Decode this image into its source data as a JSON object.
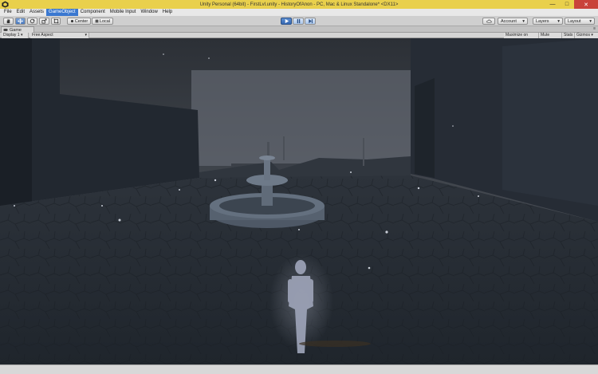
{
  "window": {
    "title": "Unity Personal (64bit) - FirstLvl.unity - HistoryOfAnon - PC, Mac & Linux Standalone* <DX11>",
    "minimize_glyph": "—",
    "maximize_glyph": "□",
    "close_glyph": "✕"
  },
  "menu": {
    "items": [
      "File",
      "Edit",
      "Assets",
      "GameObject",
      "Component",
      "Mobile Input",
      "Window",
      "Help"
    ],
    "active_index": 3
  },
  "toolbar": {
    "tools": [
      "hand-tool",
      "move-tool",
      "rotate-tool",
      "scale-tool",
      "rect-tool"
    ],
    "pivot_label": "Center",
    "space_label": "Local",
    "account_label": "Account",
    "layers_label": "Layers",
    "layout_label": "Layout"
  },
  "game_view": {
    "tab_label": "Game",
    "window_menu": "≡",
    "display_label": "Display 1",
    "aspect_label": "Free Aspect",
    "maximize_on_play": "Maximize on Play",
    "mute_audio": "Mute audio",
    "stats": "Stats",
    "gizmos": "Gizmos"
  },
  "colors": {
    "title_bar": "#e9d04c",
    "menu_active": "#3a78d0",
    "play_active": "#3568b3",
    "close_button": "#c9423a"
  }
}
